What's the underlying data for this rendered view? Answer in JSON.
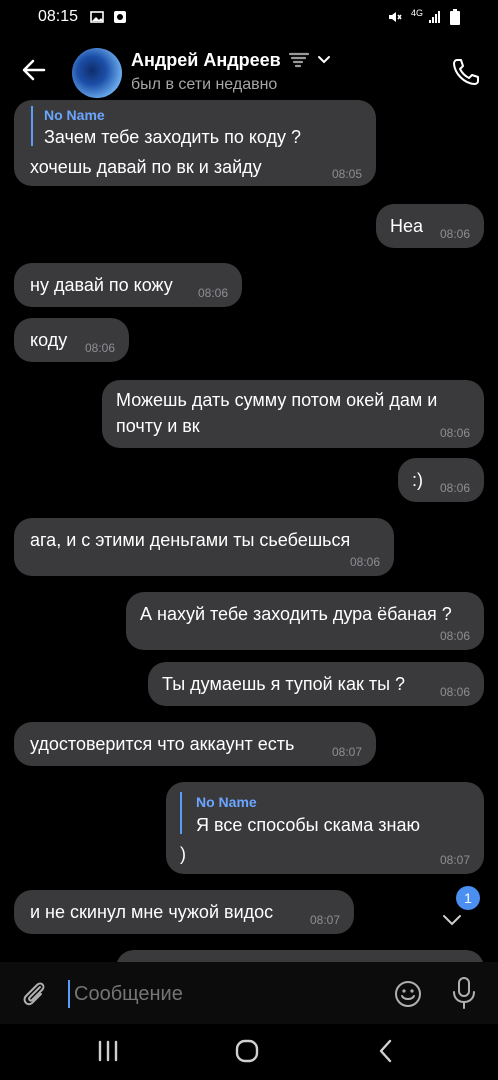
{
  "status_bar": {
    "time": "08:15",
    "network": "4G"
  },
  "header": {
    "name": "Андрей Андреев",
    "status": "был в сети недавно"
  },
  "messages": [
    {
      "quote_name": "No Name",
      "quote_text": "Зачем тебе заходить по коду ?",
      "text": "хочешь давай по вк и зайду",
      "time": "08:05"
    },
    {
      "text": "Неа",
      "time": "08:06"
    },
    {
      "text": "ну давай по кожу",
      "time": "08:06"
    },
    {
      "text": "коду",
      "time": "08:06"
    },
    {
      "line1": "Можешь дать сумму потом окей дам и",
      "line2": "почту и вк",
      "time": "08:06"
    },
    {
      "text": ":)",
      "time": "08:06"
    },
    {
      "text": "ага, и с этими деньгами ты сьебешься",
      "time": "08:06"
    },
    {
      "text": "А нахуй тебе заходить дура ёбаная ?",
      "time": "08:06"
    },
    {
      "text": "Ты думаешь я тупой как ты ?",
      "time": "08:06"
    },
    {
      "text": "удостоверится что аккаунт есть",
      "time": "08:07"
    },
    {
      "quote_name": "No Name",
      "quote_text": "Я все способы скама знаю",
      "text": ")",
      "time": "08:07"
    },
    {
      "text": "и не скинул мне чужой видос",
      "time": "08:07"
    }
  ],
  "unread_badge": "1",
  "input": {
    "placeholder": "Сообщение"
  },
  "colors": {
    "bubble": "#3a3a3c",
    "accent": "#5a9cf8",
    "background": "#000000"
  }
}
